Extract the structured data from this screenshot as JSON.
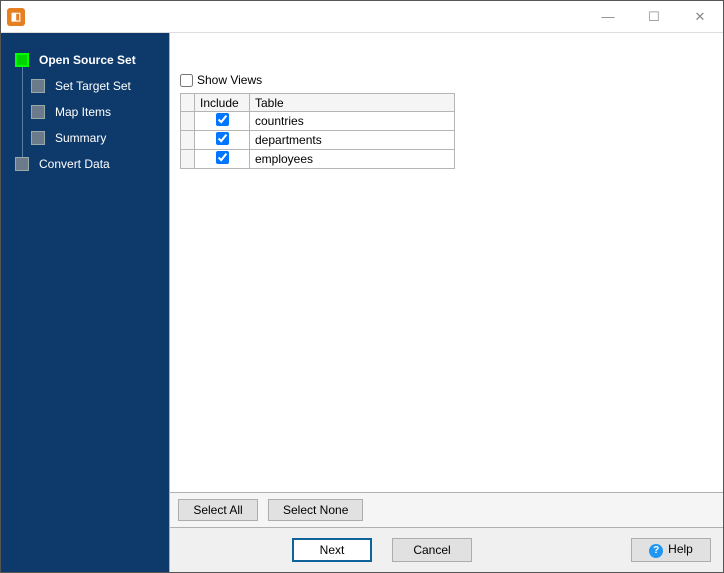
{
  "title": "",
  "sidebar": {
    "steps": [
      {
        "label": "Open Source Set",
        "active": true,
        "sub": false
      },
      {
        "label": "Set Target Set",
        "active": false,
        "sub": true
      },
      {
        "label": "Map Items",
        "active": false,
        "sub": true
      },
      {
        "label": "Summary",
        "active": false,
        "sub": true
      },
      {
        "label": "Convert Data",
        "active": false,
        "sub": false
      }
    ]
  },
  "content": {
    "show_views_label": "Show Views",
    "show_views_checked": false,
    "columns": {
      "include": "Include",
      "table": "Table"
    },
    "rows": [
      {
        "include": true,
        "table": "countries"
      },
      {
        "include": true,
        "table": "departments"
      },
      {
        "include": true,
        "table": "employees"
      }
    ]
  },
  "selection": {
    "select_all": "Select All",
    "select_none": "Select None"
  },
  "buttons": {
    "next": "Next",
    "cancel": "Cancel",
    "help": "Help"
  },
  "win": {
    "min": "—",
    "max": "☐",
    "close": "✕"
  }
}
